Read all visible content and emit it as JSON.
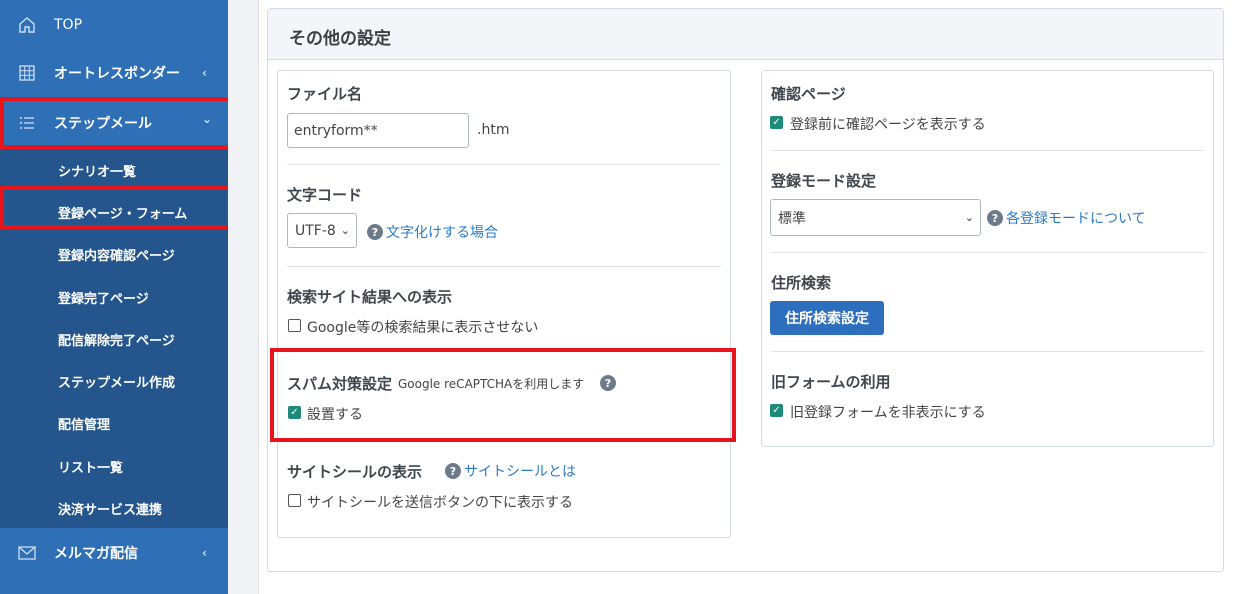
{
  "sidebar": {
    "items": [
      {
        "icon": "home-icon",
        "label": "TOP"
      },
      {
        "icon": "grid-icon",
        "label": "オートレスポンダー"
      },
      {
        "icon": "list-icon",
        "label": "ステップメール"
      },
      {
        "icon": "mail-icon",
        "label": "メルマガ配信"
      }
    ],
    "submenu": [
      "シナリオ一覧",
      "登録ページ・フォーム",
      "登録内容確認ページ",
      "登録完了ページ",
      "配信解除完了ページ",
      "ステップメール作成",
      "配信管理",
      "リスト一覧",
      "決済サービス連携"
    ],
    "chevron_left": "‹",
    "chevron_down": "⌄"
  },
  "card": {
    "title": "その他の設定"
  },
  "left": {
    "filename": {
      "title": "ファイル名",
      "value": "entryform**",
      "suffix": ".htm"
    },
    "charset": {
      "title": "文字コード",
      "selected": "UTF-8",
      "help_link": "文字化けする場合"
    },
    "search": {
      "title": "検索サイト結果への表示",
      "checkbox_label": "Google等の検索結果に表示させない",
      "checked": false
    },
    "spam": {
      "title": "スパム対策設定",
      "subtitle": "Google reCAPTCHAを利用します",
      "checkbox_label": "設置する",
      "checked": true
    },
    "seal": {
      "title": "サイトシールの表示",
      "help_link": "サイトシールとは",
      "checkbox_label": "サイトシールを送信ボタンの下に表示する",
      "checked": false
    }
  },
  "right": {
    "confirm": {
      "title": "確認ページ",
      "checkbox_label": "登録前に確認ページを表示する",
      "checked": true
    },
    "mode": {
      "title": "登録モード設定",
      "selected": "標準",
      "help_link": "各登録モードについて"
    },
    "address": {
      "title": "住所検索",
      "button_label": "住所検索設定"
    },
    "oldform": {
      "title": "旧フォームの利用",
      "checkbox_label": "旧登録フォームを非表示にする",
      "checked": true
    }
  },
  "colors": {
    "sidebar": "#2f6fb5",
    "submenu": "#24558c",
    "highlight": "#e8141b",
    "link": "#2a7bc4",
    "button": "#2d6fbc",
    "checkbox": "#1d8a7a"
  }
}
